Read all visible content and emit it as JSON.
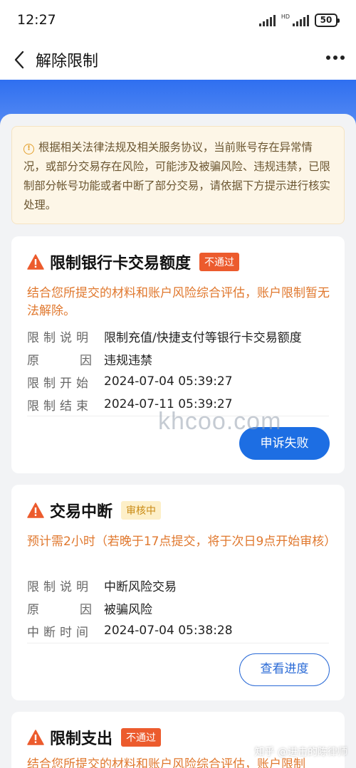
{
  "status_bar": {
    "time": "12:27",
    "battery": "50"
  },
  "nav": {
    "title": "解除限制"
  },
  "notice": {
    "text": "根据相关法律法规及相关服务协议，当前账号存在异常情况，或部分交易存在风险，可能涉及被骗风险、违规违禁，已限制部分帐号功能或者中断了部分交易，请依据下方提示进行核实处理。"
  },
  "cards": [
    {
      "title": "限制银行卡交易额度",
      "badge": "不通过",
      "description": "结合您所提交的材料和账户风险综合评估，账户限制暂无法解除。",
      "rows": [
        {
          "label": "限制说明",
          "value": "限制充值/快捷支付等银行卡交易额度"
        },
        {
          "label_a": "原",
          "label_b": "因",
          "value": "违规违禁"
        },
        {
          "label": "限制开始",
          "value": "2024-07-04 05:39:27"
        },
        {
          "label": "限制结束",
          "value": "2024-07-11 05:39:27"
        }
      ],
      "button": "申诉失败"
    },
    {
      "title": "交易中断",
      "badge": "审核中",
      "description": "预计需2小时（若晚于17点提交，将于次日9点开始审核）",
      "rows": [
        {
          "label": "限制说明",
          "value": "中断风险交易"
        },
        {
          "label_a": "原",
          "label_b": "因",
          "value": "被骗风险"
        },
        {
          "label": "中断时间",
          "value": "2024-07-04 05:38:28"
        }
      ],
      "button": "查看进度"
    },
    {
      "title": "限制支出",
      "badge": "不通过",
      "description": "结合您所提交的材料和账户风险综合评估，账户限制"
    }
  ],
  "watermarks": {
    "site": "khcoo.com",
    "zhihu": "知乎 @进击的陈律师"
  },
  "colors": {
    "accent_blue": "#1d6ee3",
    "warning_orange": "#e0782e",
    "fail_badge": "#ec5b2d"
  }
}
